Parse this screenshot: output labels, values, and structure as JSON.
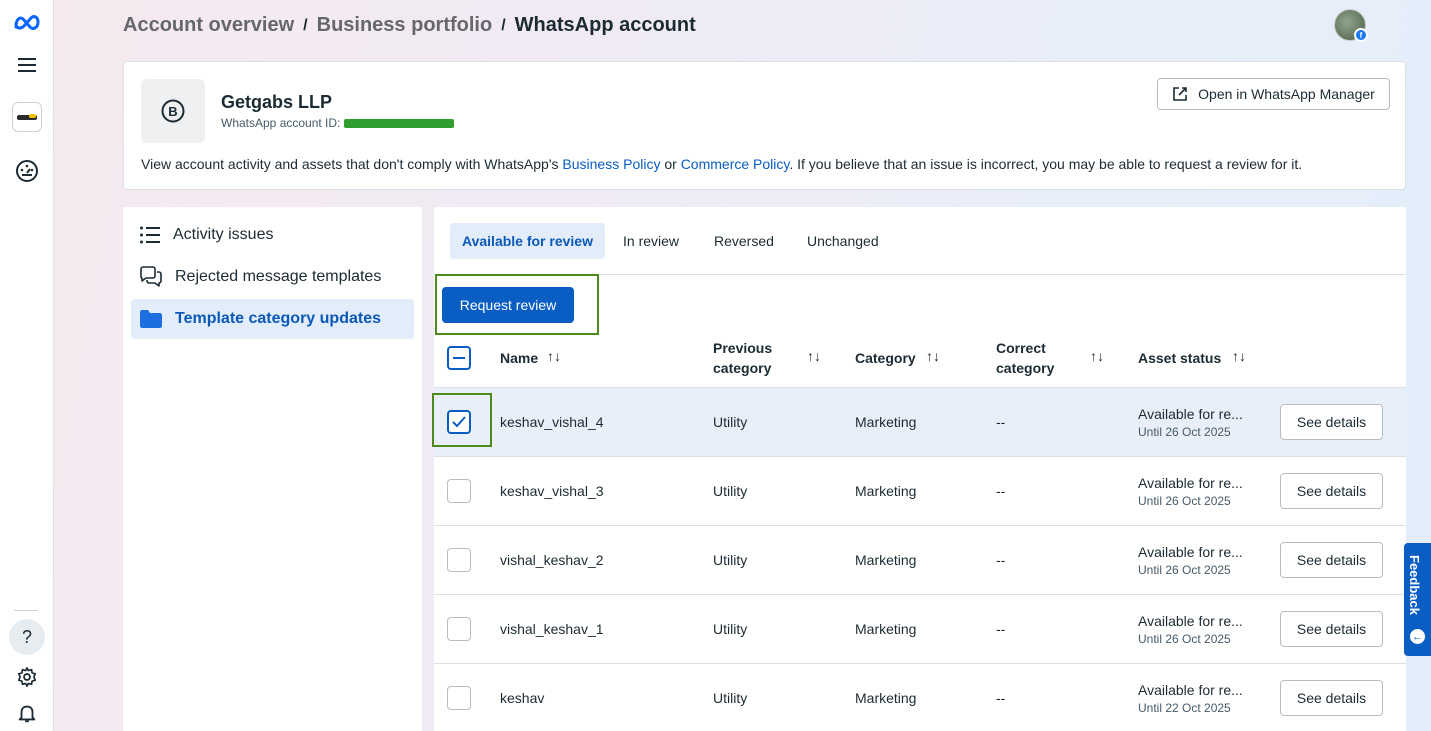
{
  "breadcrumb": {
    "item1": "Account overview",
    "item2": "Business portfolio",
    "current": "WhatsApp account",
    "separator": "/"
  },
  "account": {
    "name": "Getgabs LLP",
    "id_label": "WhatsApp account ID:",
    "open_button": "Open in WhatsApp Manager",
    "policy_prefix": "View account activity and assets that don't comply with WhatsApp's ",
    "business_policy": "Business Policy",
    "policy_or": " or ",
    "commerce_policy": "Commerce Policy",
    "policy_suffix": ". If you believe that an issue is incorrect, you may be able to request a review for it."
  },
  "side_nav": {
    "items": [
      {
        "label": "Activity issues",
        "icon": "list-icon"
      },
      {
        "label": "Rejected message templates",
        "icon": "chat-bubbles-icon"
      },
      {
        "label": "Template category updates",
        "icon": "folder-icon",
        "active": true
      }
    ]
  },
  "tabs": [
    {
      "label": "Available for review",
      "active": true
    },
    {
      "label": "In review"
    },
    {
      "label": "Reversed"
    },
    {
      "label": "Unchanged"
    }
  ],
  "actions": {
    "request_review": "Request review"
  },
  "table": {
    "headers": {
      "name": "Name",
      "previous_line1": "Previous",
      "previous_line2": "category",
      "category": "Category",
      "correct_line1": "Correct",
      "correct_line2": "category",
      "status": "Asset status",
      "sort_glyph": "↑↓"
    },
    "rows": [
      {
        "name": "keshav_vishal_4",
        "previous": "Utility",
        "category": "Marketing",
        "correct": "--",
        "status": "Available for re...",
        "until": "Until 26 Oct 2025",
        "action": "See details",
        "selected": true
      },
      {
        "name": "keshav_vishal_3",
        "previous": "Utility",
        "category": "Marketing",
        "correct": "--",
        "status": "Available for re...",
        "until": "Until 26 Oct 2025",
        "action": "See details",
        "selected": false
      },
      {
        "name": "vishal_keshav_2",
        "previous": "Utility",
        "category": "Marketing",
        "correct": "--",
        "status": "Available for re...",
        "until": "Until 26 Oct 2025",
        "action": "See details",
        "selected": false
      },
      {
        "name": "vishal_keshav_1",
        "previous": "Utility",
        "category": "Marketing",
        "correct": "--",
        "status": "Available for re...",
        "until": "Until 26 Oct 2025",
        "action": "See details",
        "selected": false
      },
      {
        "name": "keshav",
        "previous": "Utility",
        "category": "Marketing",
        "correct": "--",
        "status": "Available for re...",
        "until": "Until 22 Oct 2025",
        "action": "See details",
        "selected": false
      }
    ]
  },
  "rail": {
    "icons": [
      "meta-logo-icon",
      "menu-icon",
      "business-logo-icon",
      "dashboard-gauge-icon",
      "help-icon",
      "settings-icon",
      "bell-icon"
    ],
    "help_glyph": "?"
  },
  "feedback": {
    "label": "Feedback"
  },
  "colors": {
    "accent": "#0a5dc2",
    "highlight_outline": "#4d8a1c",
    "redaction": "#2f9e2f"
  }
}
